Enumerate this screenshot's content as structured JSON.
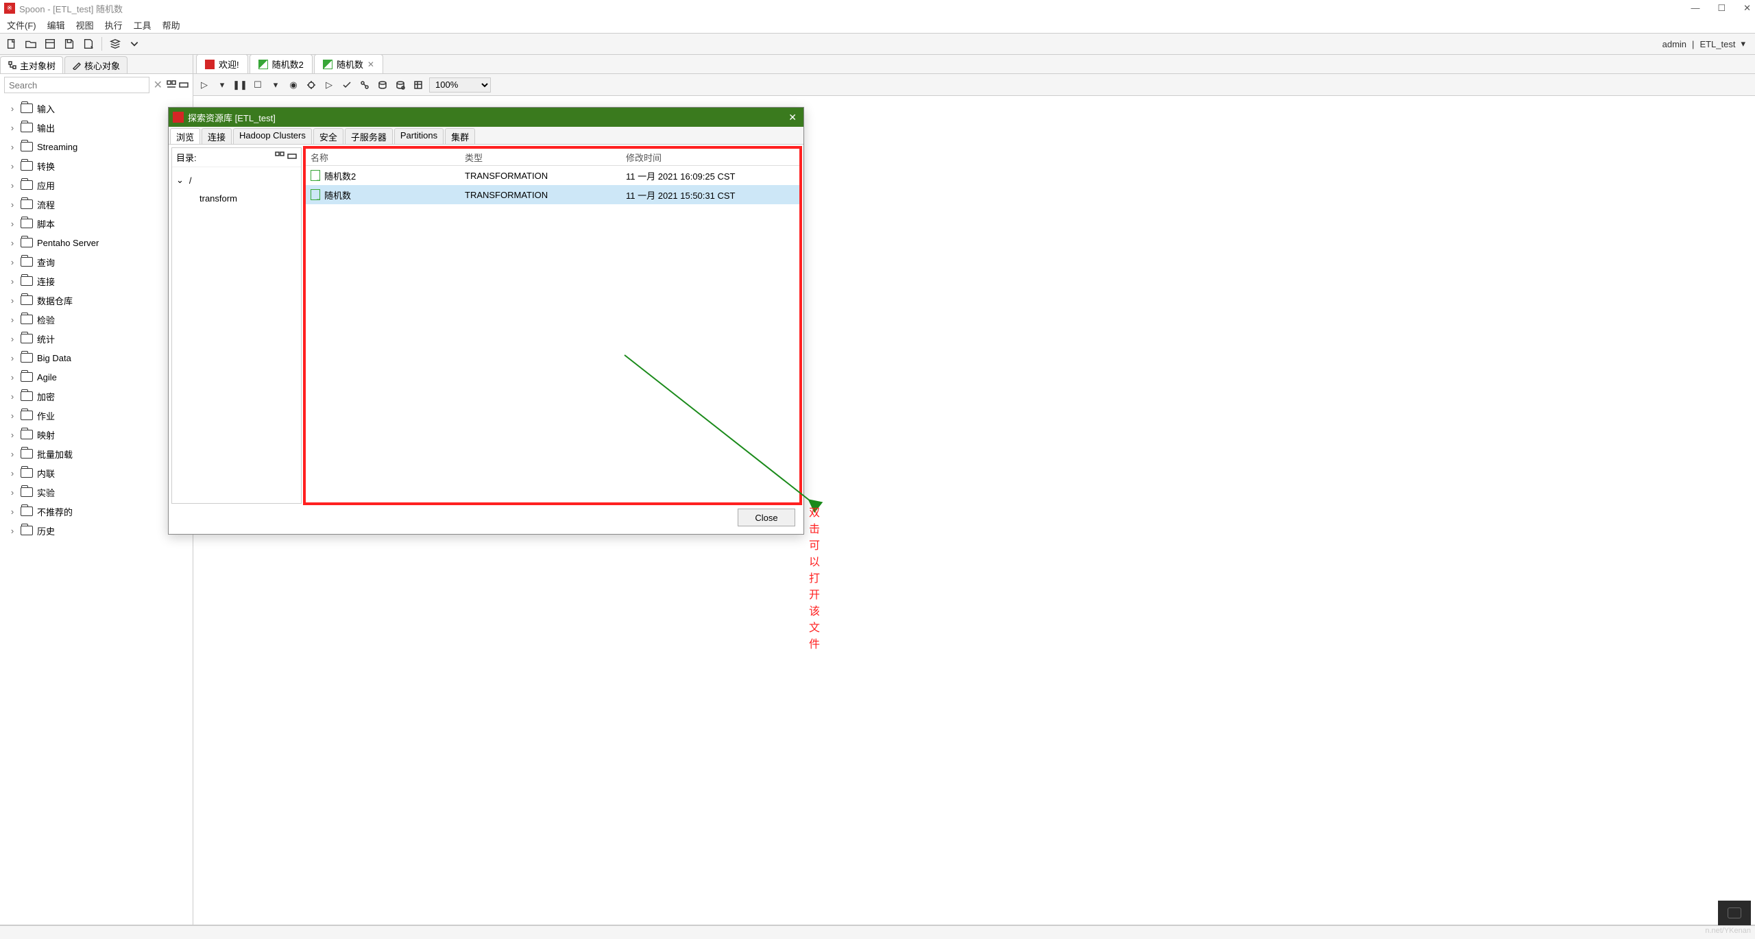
{
  "window": {
    "title": "Spoon - [ETL_test] 随机数"
  },
  "menu": {
    "file": "文件(F)",
    "edit": "编辑",
    "view": "视图",
    "run": "执行",
    "tools": "工具",
    "help": "帮助"
  },
  "user": {
    "name": "admin",
    "separator": "|",
    "connection": "ETL_test"
  },
  "leftPanel": {
    "tabs": {
      "main": "主对象树",
      "core": "核心对象"
    },
    "searchPlaceholder": "Search",
    "treeItems": [
      "输入",
      "输出",
      "Streaming",
      "转换",
      "应用",
      "流程",
      "脚本",
      "Pentaho Server",
      "查询",
      "连接",
      "数据仓库",
      "检验",
      "统计",
      "Big Data",
      "Agile",
      "加密",
      "作业",
      "映射",
      "批量加载",
      "内联",
      "实验",
      "不推荐的",
      "历史"
    ]
  },
  "editorTabs": {
    "welcome": "欢迎!",
    "tab1": "随机数2",
    "tab2": "随机数"
  },
  "zoom": "100%",
  "dialog": {
    "title": "探索资源库 [ETL_test]",
    "tabs": {
      "browse": "浏览",
      "conn": "连接",
      "hadoop": "Hadoop Clusters",
      "security": "安全",
      "subserver": "子服务器",
      "partitions": "Partitions",
      "cluster": "集群"
    },
    "dirLabel": "目录:",
    "dirRoot": "/",
    "dirChild": "transform",
    "table": {
      "headers": {
        "name": "名称",
        "type": "类型",
        "date": "修改时间"
      },
      "rows": [
        {
          "name": "随机数2",
          "type": "TRANSFORMATION",
          "date": "11 一月 2021 16:09:25 CST",
          "selected": false
        },
        {
          "name": "随机数",
          "type": "TRANSFORMATION",
          "date": "11 一月 2021 15:50:31 CST",
          "selected": true
        }
      ]
    },
    "closeButton": "Close"
  },
  "annotation": "双击可以打开该文件",
  "watermark": "n.net/YKenan"
}
